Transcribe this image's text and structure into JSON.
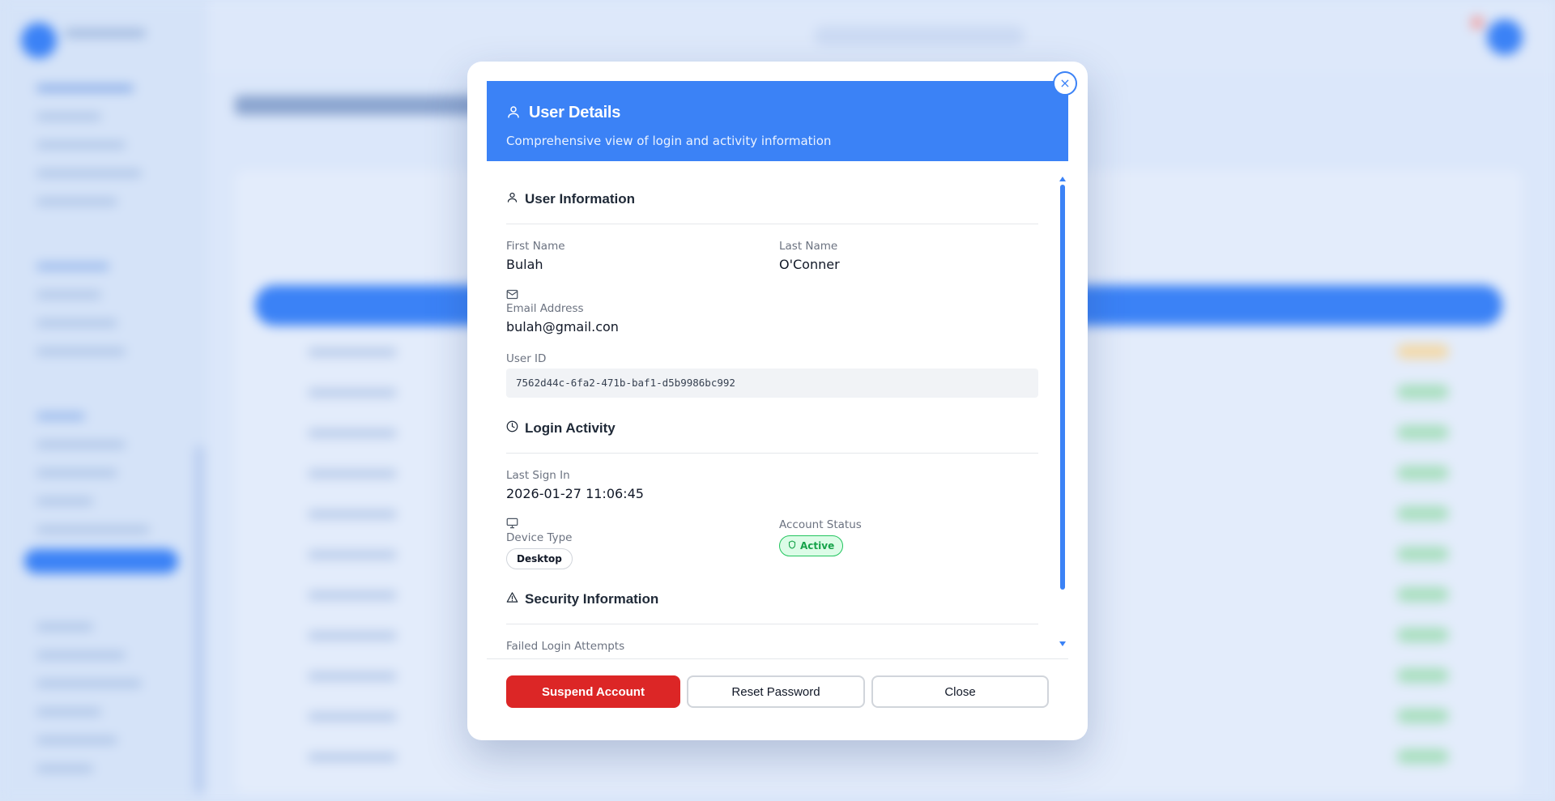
{
  "modal": {
    "title": "User Details",
    "subtitle": "Comprehensive view of login and activity information",
    "close_icon_label": "×"
  },
  "user_information": {
    "heading": "User Information",
    "first_name_label": "First Name",
    "first_name": "Bulah",
    "last_name_label": "Last Name",
    "last_name": "O'Conner",
    "email_label": "Email Address",
    "email": "bulah@gmail.con",
    "user_id_label": "User ID",
    "user_id": "7562d44c-6fa2-471b-baf1-d5b9986bc992"
  },
  "login_activity": {
    "heading": "Login Activity",
    "last_sign_in_label": "Last Sign In",
    "last_sign_in": "2026-01-27 11:06:45",
    "device_type_label": "Device Type",
    "device_type": "Desktop",
    "account_status_label": "Account Status",
    "account_status": "Active"
  },
  "security_information": {
    "heading": "Security Information",
    "failed_login_label": "Failed Login Attempts"
  },
  "actions": {
    "suspend": "Suspend Account",
    "reset": "Reset Password",
    "close": "Close"
  },
  "colors": {
    "accent": "#3b82f6",
    "danger": "#dc2626",
    "success": "#16a34a"
  },
  "icons": {
    "header": "user-icon",
    "user_section": "user-icon",
    "email": "mail-icon",
    "login_section": "clock-icon",
    "device": "monitor-icon",
    "status": "shield-icon",
    "security_section": "alert-triangle-icon",
    "close": "close-icon"
  }
}
